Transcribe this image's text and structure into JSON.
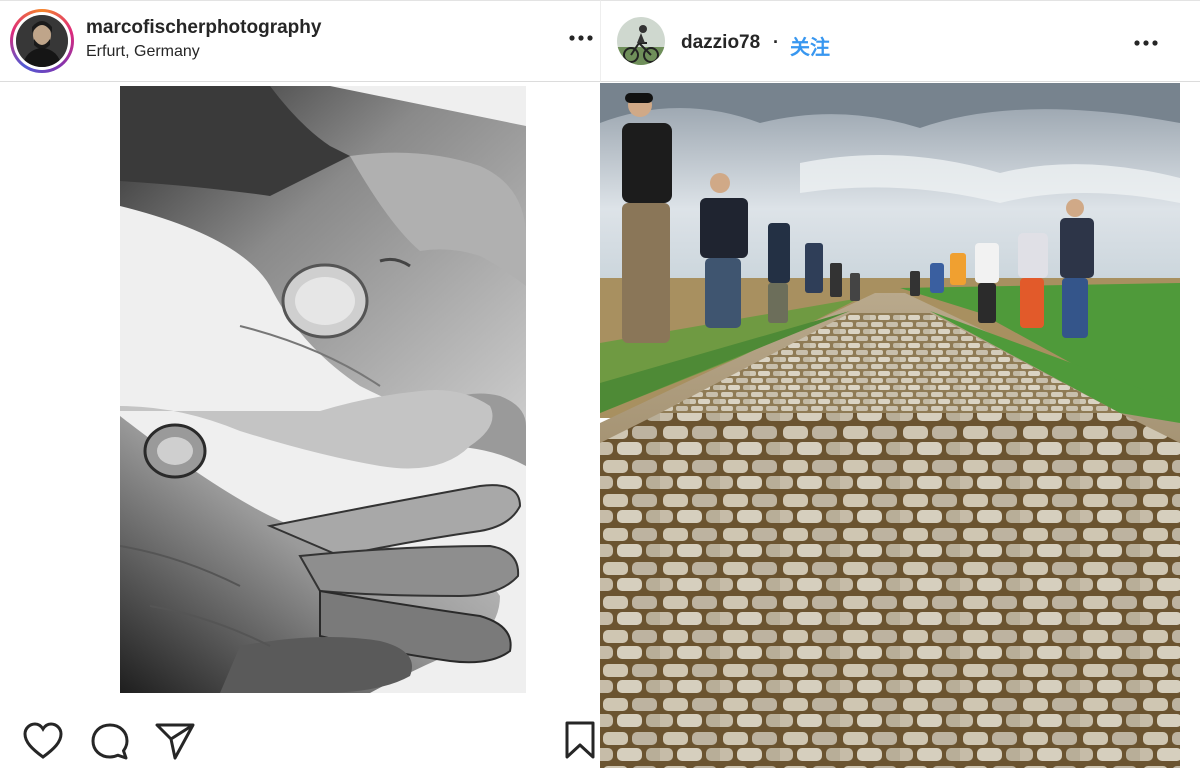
{
  "posts": [
    {
      "username": "marcofischerphotography",
      "location": "Erfurt, Germany",
      "avatar_icon": "profile-avatar",
      "more_icon": "more-horizontal-icon",
      "image_subject": "black-and-white photo of two open hands with blisters",
      "actions": [
        "heart-icon",
        "comment-icon",
        "share-icon",
        "bookmark-icon"
      ]
    },
    {
      "username": "dazzio78",
      "separator": "·",
      "follow_label": "关注",
      "avatar_icon": "cyclist-avatar",
      "more_icon": "more-horizontal-icon",
      "image_subject": "cobblestone road lined by spectators under cloudy sky"
    }
  ],
  "colors": {
    "accent": "#3897f0",
    "text": "#262626",
    "divider": "#dbdbdb"
  }
}
